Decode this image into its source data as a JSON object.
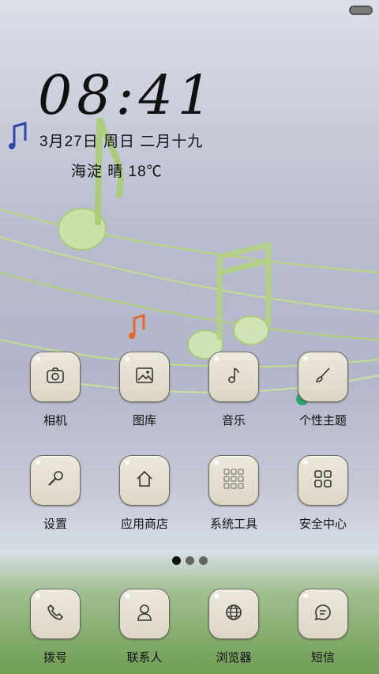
{
  "lockscreen": {
    "time": "08:41",
    "date": "3月27日  周日  二月十九",
    "weather": "海淀  晴  18℃"
  },
  "apps_row1": [
    {
      "label": "相机",
      "icon": "camera-icon"
    },
    {
      "label": "图库",
      "icon": "gallery-icon"
    },
    {
      "label": "音乐",
      "icon": "music-note-icon"
    },
    {
      "label": "个性主题",
      "icon": "paintbrush-icon"
    }
  ],
  "apps_row2": [
    {
      "label": "设置",
      "icon": "wrench-icon"
    },
    {
      "label": "应用商店",
      "icon": "home-icon"
    },
    {
      "label": "系统工具",
      "icon": "tools-folder-icon"
    },
    {
      "label": "安全中心",
      "icon": "grid-icon"
    }
  ],
  "dock": [
    {
      "label": "拨号",
      "icon": "phone-icon"
    },
    {
      "label": "联系人",
      "icon": "contact-icon"
    },
    {
      "label": "浏览器",
      "icon": "globe-icon"
    },
    {
      "label": "短信",
      "icon": "message-icon"
    }
  ],
  "page_indicator": {
    "pages": 3,
    "active": 1
  }
}
